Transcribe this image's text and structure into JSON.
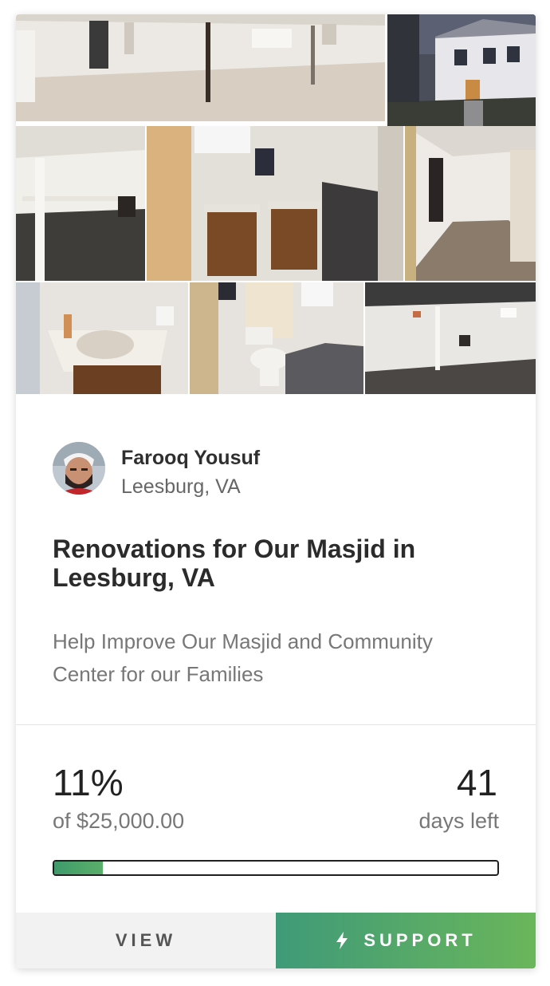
{
  "creator": {
    "name": "Farooq Yousuf",
    "location": "Leesburg, VA"
  },
  "campaign": {
    "title": "Renovations for Our Masjid in Leesburg, VA",
    "subtitle": "Help Improve Our Masjid and Community Center for our Families"
  },
  "stats": {
    "percent_label": "11%",
    "goal_label": "of $25,000.00",
    "days_value": "41",
    "days_label": "days left",
    "progress_fraction": 0.11
  },
  "actions": {
    "view_label": "VIEW",
    "support_label": "SUPPORT",
    "support_icon": "lightning-bolt-icon"
  },
  "colors": {
    "accent_green": "#4fa66a",
    "support_gradient_start": "#3f9a78",
    "support_gradient_end": "#6ab65b"
  }
}
